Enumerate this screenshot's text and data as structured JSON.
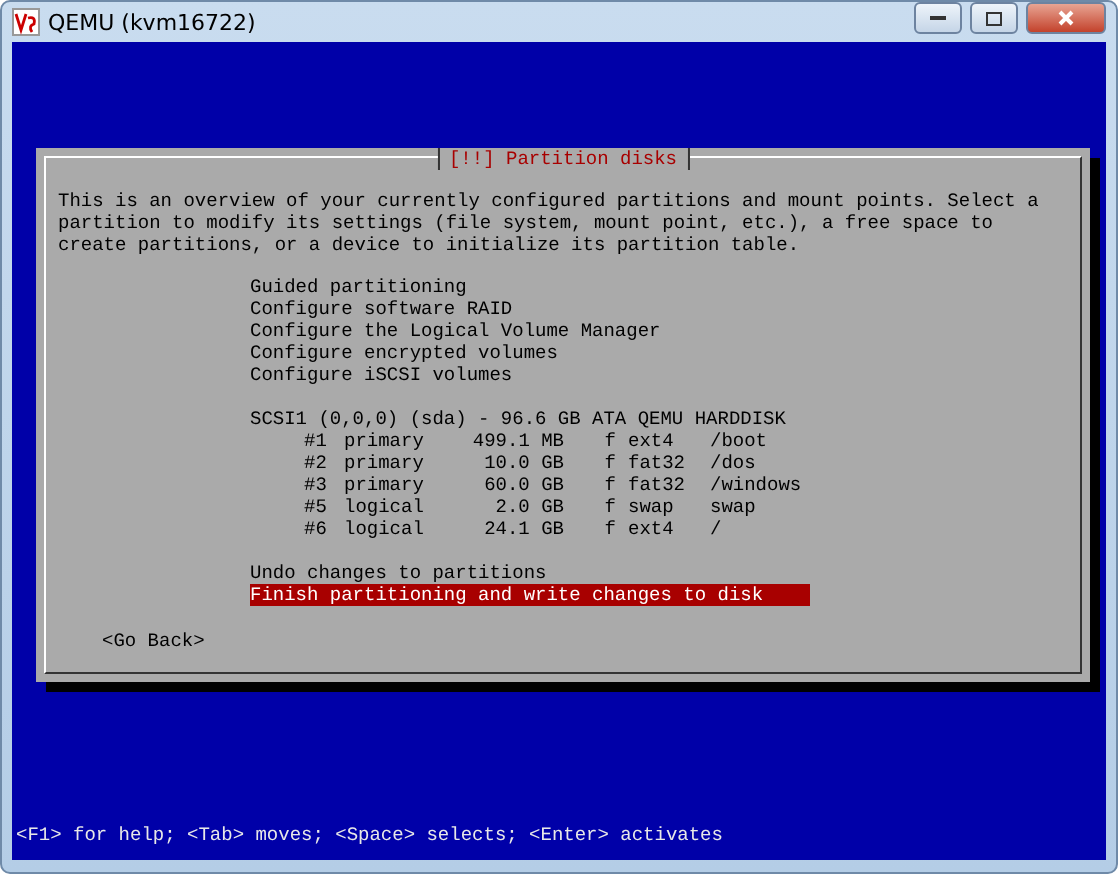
{
  "window": {
    "title": "QEMU (kvm16722)"
  },
  "dialog": {
    "title": "[!!] Partition disks",
    "description": "This is an overview of your currently configured partitions and mount points. Select a partition to modify its settings (file system, mount point, etc.), a free space to create partitions, or a device to initialize its partition table.",
    "actions": [
      {
        "label": "Guided partitioning",
        "selected": false
      },
      {
        "label": "Configure software RAID",
        "selected": false
      },
      {
        "label": "Configure the Logical Volume Manager",
        "selected": false
      },
      {
        "label": "Configure encrypted volumes",
        "selected": false
      },
      {
        "label": "Configure iSCSI volumes",
        "selected": false
      }
    ],
    "disk": {
      "label": "SCSI1 (0,0,0) (sda) - 96.6 GB ATA QEMU HARDDISK",
      "selected": false,
      "partitions": [
        {
          "number": "#1",
          "type": "primary",
          "size": "499.1 MB",
          "flag": "f",
          "filesystem": "ext4",
          "mount": "/boot",
          "selected": false
        },
        {
          "number": "#2",
          "type": "primary",
          "size": "10.0 GB",
          "flag": "f",
          "filesystem": "fat32",
          "mount": "/dos",
          "selected": false
        },
        {
          "number": "#3",
          "type": "primary",
          "size": "60.0 GB",
          "flag": "f",
          "filesystem": "fat32",
          "mount": "/windows",
          "selected": false
        },
        {
          "number": "#5",
          "type": "logical",
          "size": "2.0 GB",
          "flag": "f",
          "filesystem": "swap",
          "mount": "swap",
          "selected": false
        },
        {
          "number": "#6",
          "type": "logical",
          "size": "24.1 GB",
          "flag": "f",
          "filesystem": "ext4",
          "mount": "/",
          "selected": false
        }
      ]
    },
    "final_actions": [
      {
        "label": "Undo changes to partitions",
        "selected": false
      },
      {
        "label": "Finish partitioning and write changes to disk",
        "selected": true
      }
    ],
    "back_button": "<Go Back>"
  },
  "status_bar": "<F1> for help; <Tab> moves; <Space> selects; <Enter> activates"
}
